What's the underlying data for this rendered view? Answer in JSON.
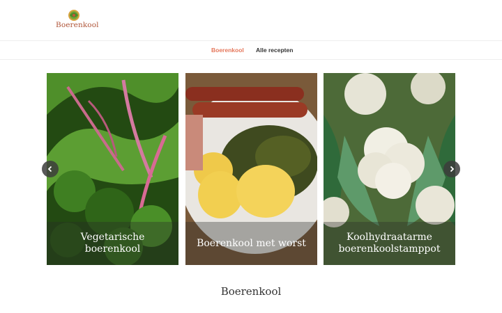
{
  "brand": {
    "logo_text": "Boerenkool",
    "accent": "#e5765a",
    "logo_color": "#b0563a"
  },
  "nav": {
    "items": [
      {
        "label": "Boerenkool",
        "active": true
      },
      {
        "label": "Alle recepten",
        "active": false
      }
    ]
  },
  "carousel": {
    "slides": [
      {
        "caption": "Vegetarische boerenkool",
        "image": "kale-leaves"
      },
      {
        "caption": "Boerenkool met worst",
        "image": "sausage-stamppot"
      },
      {
        "caption": "Koolhydraatarme boerenkoolstamppot",
        "image": "cauliflower"
      }
    ],
    "prev_icon": "chevron-left-icon",
    "next_icon": "chevron-right-icon"
  },
  "section": {
    "title": "Boerenkool"
  }
}
